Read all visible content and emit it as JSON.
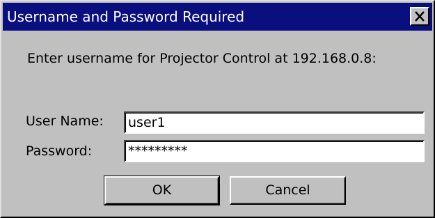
{
  "dialog": {
    "title": "Username and Password Required",
    "close_label": "close",
    "prompt": "Enter username for Projector Control at 192.168.0.8:"
  },
  "form": {
    "username_label": "User Name:",
    "username_value": "user1",
    "password_label": "Password:",
    "password_value": "*********"
  },
  "buttons": {
    "ok_label": "OK",
    "cancel_label": "Cancel"
  },
  "colors": {
    "titlebar": "#0a0f80",
    "face": "#c0c0c0"
  },
  "icons": {
    "close": "close-icon"
  }
}
